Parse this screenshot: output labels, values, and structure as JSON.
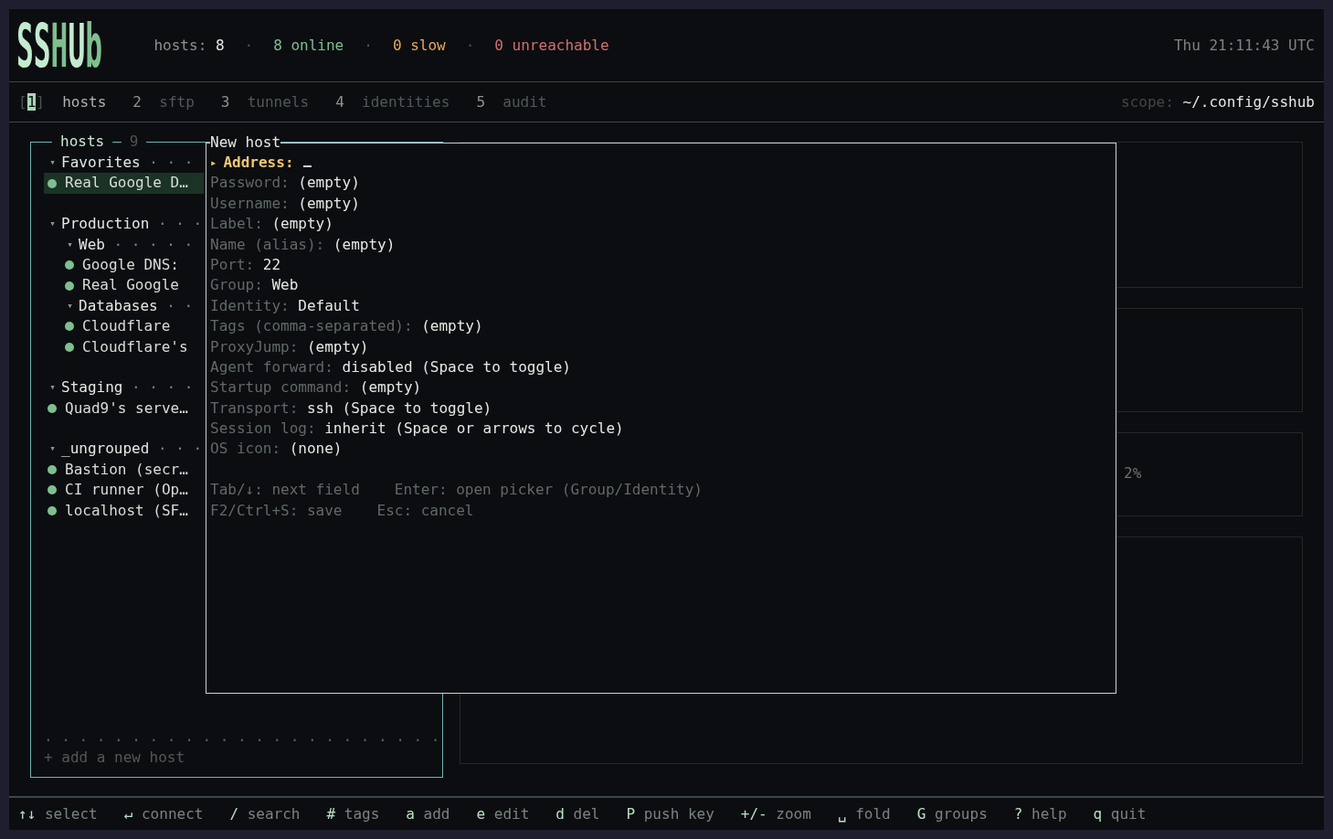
{
  "logo": "SSHUb",
  "stats": [
    {
      "kind": "total",
      "label": "hosts:",
      "value": "8"
    },
    {
      "kind": "online",
      "text": "8 online"
    },
    {
      "kind": "slow",
      "text": "0 slow"
    },
    {
      "kind": "unreachable",
      "text": "0 unreachable"
    }
  ],
  "stat_separator": "·",
  "clock": "Thu 21:11:43 UTC",
  "tab_brackets": [
    "[",
    "]"
  ],
  "tabs": [
    {
      "key": "1",
      "label": "hosts",
      "selected": true
    },
    {
      "key": "2",
      "label": "sftp",
      "selected": false
    },
    {
      "key": "3",
      "label": "tunnels",
      "selected": false
    },
    {
      "key": "4",
      "label": "identities",
      "selected": false
    },
    {
      "key": "5",
      "label": "audit",
      "selected": false
    }
  ],
  "scope": {
    "label": "scope:",
    "value": "~/.config/sshub"
  },
  "hosts_panel": {
    "title": "hosts",
    "dash": "—",
    "count": "9",
    "caret": "▾",
    "tree": [
      {
        "kind": "group",
        "label": "Favorites",
        "leader": "· · ·",
        "expanded": true,
        "children": [
          {
            "kind": "host",
            "label": "Real Google D…",
            "color": "#7fbf8f",
            "selected": true
          }
        ]
      },
      {
        "kind": "group",
        "label": "Production",
        "leader": "· · ·",
        "expanded": true,
        "children": [
          {
            "kind": "group",
            "label": "Web",
            "leader": "· · · · ·",
            "expanded": true,
            "children": [
              {
                "kind": "host",
                "label": "Google DNS:",
                "color": "#7fbf8f",
                "selected": false
              },
              {
                "kind": "host",
                "label": "Real Google",
                "color": "#7fbf8f",
                "selected": false
              }
            ]
          },
          {
            "kind": "group",
            "label": "Databases",
            "leader": "· ·",
            "expanded": true,
            "children": [
              {
                "kind": "host",
                "label": "Cloudflare",
                "color": "#7fbf8f",
                "selected": false
              },
              {
                "kind": "host",
                "label": "Cloudflare's",
                "color": "#7fbf8f",
                "selected": false
              }
            ]
          }
        ]
      },
      {
        "kind": "group",
        "label": "Staging",
        "leader": "· · · ·",
        "expanded": true,
        "children": [
          {
            "kind": "host",
            "label": "Quad9's serve…",
            "color": "#7fbf8f",
            "selected": false
          }
        ]
      },
      {
        "kind": "group",
        "label": "_ungrouped",
        "leader": "· · ·",
        "expanded": true,
        "children": [
          {
            "kind": "host",
            "label": "Bastion (secr…",
            "color": "#7fbf8f",
            "selected": false
          },
          {
            "kind": "host",
            "label": "CI runner (Op…",
            "color": "#7fbf8f",
            "selected": false
          },
          {
            "kind": "host",
            "label": "localhost (SF…",
            "color": "#7fbf8f",
            "selected": false
          }
        ]
      }
    ],
    "dotted_rule": ". . . . . . . . . . . . . . . . . . . . . . .",
    "add_host": "+ add a new host"
  },
  "detail_reading": "2%",
  "modal": {
    "title": "New host",
    "pointer": "▸",
    "fields": [
      {
        "label": "Address:",
        "selected": true
      },
      {
        "label": "Password:",
        "value": "(empty)",
        "selected": false
      },
      {
        "label": "Username:",
        "value": "(empty)",
        "selected": false
      },
      {
        "label": "Label:",
        "value": "(empty)",
        "selected": false
      },
      {
        "label": "Name (alias):",
        "value": "(empty)",
        "selected": false
      },
      {
        "label": "Port:",
        "value": "22",
        "selected": false
      },
      {
        "label": "Group:",
        "value": "Web",
        "selected": false
      },
      {
        "label": "Identity:",
        "value": "Default",
        "selected": false
      },
      {
        "label": "Tags (comma-separated):",
        "value": "(empty)",
        "selected": false
      },
      {
        "label": "ProxyJump:",
        "value": "(empty)",
        "selected": false
      },
      {
        "label": "Agent forward:",
        "value": "disabled (Space to toggle)",
        "selected": false
      },
      {
        "label": "Startup command:",
        "value": "(empty)",
        "selected": false
      },
      {
        "label": "Transport:",
        "value": "ssh (Space to toggle)",
        "selected": false
      },
      {
        "label": "Session log:",
        "value": "inherit (Space or arrows to cycle)",
        "selected": false
      },
      {
        "label": "OS icon:",
        "value": "(none)",
        "selected": false
      }
    ],
    "hints": [
      [
        {
          "key": "Tab/↓:",
          "text": "next field"
        },
        {
          "key": "Enter:",
          "text": "open picker (Group/Identity)"
        }
      ],
      [
        {
          "key": "F2/Ctrl+S:",
          "text": "save"
        },
        {
          "key": "Esc:",
          "text": "cancel"
        }
      ]
    ]
  },
  "footer": [
    {
      "key": "↑↓",
      "label": "select"
    },
    {
      "key": "↵",
      "label": "connect"
    },
    {
      "key": "/",
      "label": "search"
    },
    {
      "key": "#",
      "label": "tags"
    },
    {
      "key": "a",
      "label": "add"
    },
    {
      "key": "e",
      "label": "edit"
    },
    {
      "key": "d",
      "label": "del"
    },
    {
      "key": "P",
      "label": "push key"
    },
    {
      "key": "+/-",
      "label": "zoom"
    },
    {
      "key": "␣",
      "label": "fold"
    },
    {
      "key": "G",
      "label": "groups"
    },
    {
      "key": "?",
      "label": "help"
    },
    {
      "key": "q",
      "label": "quit"
    }
  ]
}
